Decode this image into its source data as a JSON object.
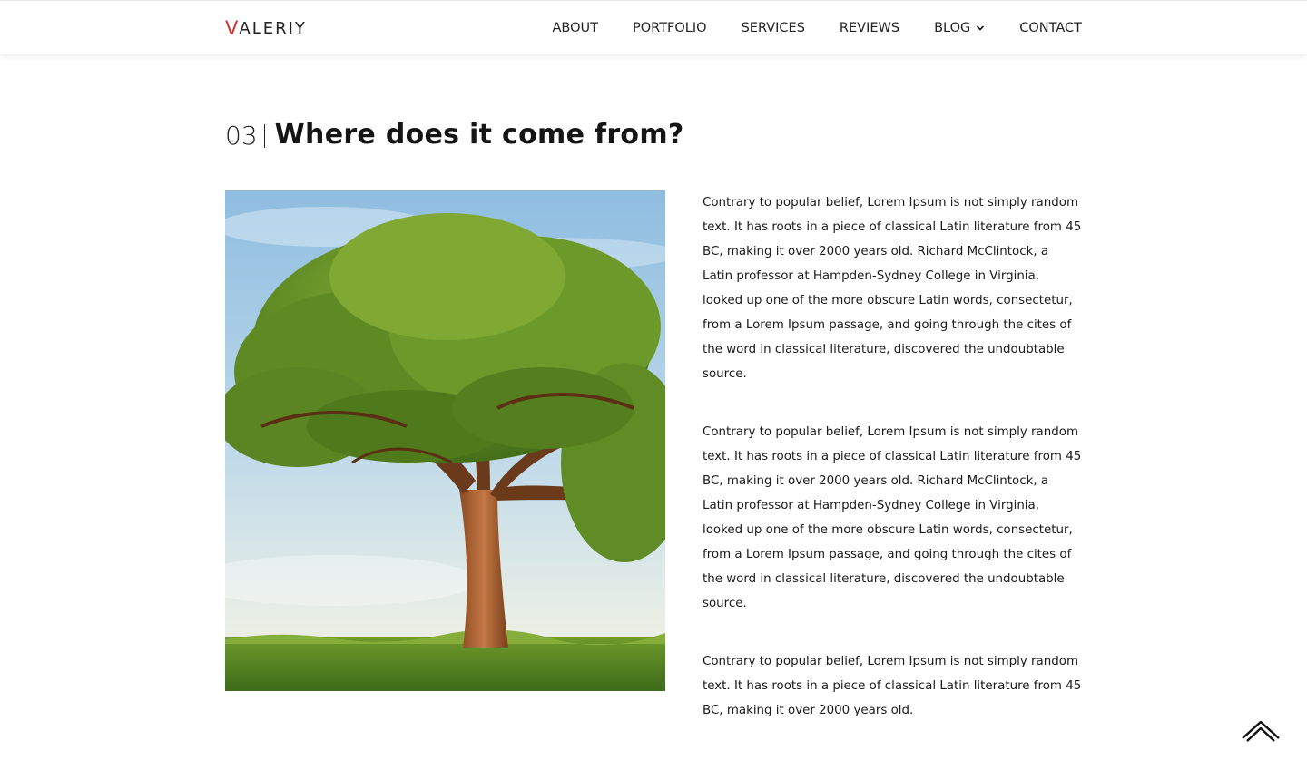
{
  "header": {
    "logo": {
      "first_letter": "V",
      "rest": "ALERIY"
    },
    "nav": [
      {
        "label": "ABOUT"
      },
      {
        "label": "PORTFOLIO"
      },
      {
        "label": "SERVICES"
      },
      {
        "label": "REVIEWS"
      },
      {
        "label": "BLOG",
        "has_dropdown": true
      },
      {
        "label": "CONTACT"
      }
    ]
  },
  "section": {
    "number": "03",
    "title": "Where does it come from?",
    "image": {
      "subject": "tree-in-field"
    },
    "paragraphs": [
      "Contrary to popular belief, Lorem Ipsum is not simply random text. It has roots in a piece of classical Latin literature from 45 BC, making it over 2000 years old. Richard McClintock, a Latin professor at Hampden-Sydney College in Virginia, looked up one of the more obscure Latin words, consectetur, from a Lorem Ipsum passage, and going through the cites of the word in classical literature, discovered the undoubtable source.",
      "Contrary to popular belief, Lorem Ipsum is not simply random text. It has roots in a piece of classical Latin literature from 45 BC, making it over 2000 years old. Richard McClintock, a Latin professor at Hampden-Sydney College in Virginia, looked up one of the more obscure Latin words, consectetur, from a Lorem Ipsum passage, and going through the cites of the word in classical literature, discovered the undoubtable source.",
      "Contrary to popular belief, Lorem Ipsum is not simply random text. It has roots in a piece of classical Latin literature from 45 BC, making it over 2000 years old."
    ]
  },
  "colors": {
    "logo_accent": "#d2322d",
    "text": "#151515"
  },
  "back_to_top": {
    "icon": "double-chevron-up-icon"
  }
}
